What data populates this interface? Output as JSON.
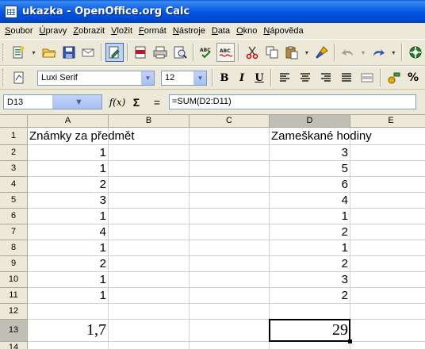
{
  "window": {
    "title": "ukazka - OpenOffice.org Calc"
  },
  "menu": [
    {
      "label": "Soubor",
      "accel": "S",
      "rest": "oubor"
    },
    {
      "label": "Úpravy",
      "accel": "Ú",
      "rest": "pravy"
    },
    {
      "label": "Zobrazit",
      "accel": "Z",
      "rest": "obrazit"
    },
    {
      "label": "Vložit",
      "accel": "V",
      "rest": "ložit"
    },
    {
      "label": "Formát",
      "accel": "F",
      "rest": "ormát"
    },
    {
      "label": "Nástroje",
      "accel": "N",
      "rest": "ástroje"
    },
    {
      "label": "Data",
      "accel": "D",
      "rest": "ata"
    },
    {
      "label": "Okno",
      "accel": "O",
      "rest": "kno"
    },
    {
      "label": "Nápověda",
      "accel": "N",
      "rest": "ápověda"
    }
  ],
  "formatting": {
    "font_name": "Luxi Serif",
    "font_size": "12",
    "bold_label": "B",
    "italic_label": "I",
    "underline_label": "U",
    "percent_label": "%"
  },
  "formula_bar": {
    "cell_ref": "D13",
    "fx_label": "f(x)",
    "sigma_label": "Σ",
    "equals_label": "=",
    "formula": "=SUM(D2:D11)"
  },
  "sheet": {
    "columns": [
      "A",
      "B",
      "C",
      "D",
      "E"
    ],
    "active_column": "D",
    "active_row": "13",
    "rows": [
      {
        "n": "1",
        "a": "Známky za předmět",
        "d": "Zameškané hodiny"
      },
      {
        "n": "2",
        "a": "1",
        "d": "3"
      },
      {
        "n": "3",
        "a": "1",
        "d": "5"
      },
      {
        "n": "4",
        "a": "2",
        "d": "6"
      },
      {
        "n": "5",
        "a": "3",
        "d": "4"
      },
      {
        "n": "6",
        "a": "1",
        "d": "1"
      },
      {
        "n": "7",
        "a": "4",
        "d": "2"
      },
      {
        "n": "8",
        "a": "1",
        "d": "1"
      },
      {
        "n": "9",
        "a": "2",
        "d": "2"
      },
      {
        "n": "10",
        "a": "1",
        "d": "3"
      },
      {
        "n": "11",
        "a": "1",
        "d": "2"
      },
      {
        "n": "12",
        "a": "",
        "d": ""
      },
      {
        "n": "13",
        "a": "1,7",
        "d": "29"
      },
      {
        "n": "14",
        "a": "",
        "d": ""
      }
    ]
  }
}
